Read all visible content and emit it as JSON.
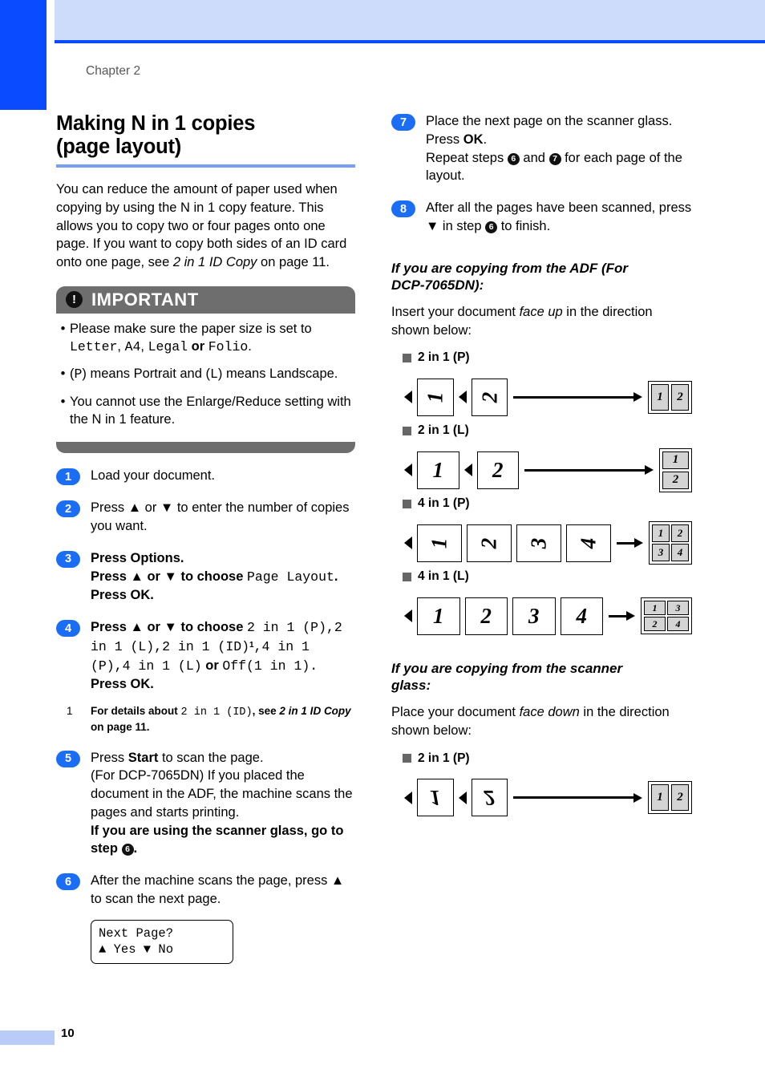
{
  "page": {
    "chapter_label": "Chapter 2",
    "page_number": "10",
    "accent_blue": "#0a4bff",
    "header_band": "#cddcfb",
    "title_rule": "#7a9ef0",
    "step_circle": "#1b6ef3",
    "important_bar": "#6e6e6e"
  },
  "title": {
    "line1": "Making N in 1 copies",
    "line2": "(page layout)"
  },
  "intro": {
    "p1_a": "You can reduce the amount of paper used when copying by using the N in 1 copy feature. This allows you to copy two or four pages onto one page. If you want to copy both sides of an ID card onto one page, see ",
    "p1_italic": "2 in 1 ID Copy",
    "p1_b": " on page 11."
  },
  "important": {
    "icon": "exclamation-icon",
    "title": "IMPORTANT",
    "items": [
      {
        "lead": "Please make sure the paper size is set to ",
        "mono1": "Letter",
        "sep1": ", ",
        "mono2": "A4",
        "sep2": ", ",
        "mono3": "Legal",
        "mid": " or ",
        "mono4": "Folio",
        "tail": "."
      },
      {
        "lead": "(",
        "mono1": "P",
        "mid": ") means Portrait and (",
        "mono2": "L",
        "tail": ") means Landscape."
      },
      {
        "lead": "You cannot use the Enlarge/Reduce setting with the N in 1 feature."
      }
    ]
  },
  "steps": [
    {
      "num": "1",
      "text": "Load your document."
    },
    {
      "num": "2",
      "text": "Press ▲ or ▼ to enter the number of copies you want."
    },
    {
      "num": "3",
      "l1_a": "Press ",
      "l1_b": "Options",
      "l1_c": ".",
      "l2_a": "Press ▲ or ▼ to choose ",
      "l2_mono": "Page Layout",
      "l2_b": ".",
      "l3_a": "Press ",
      "l3_b": "OK",
      "l3_c": "."
    },
    {
      "num": "4",
      "a": "Press ▲ or ▼ to choose ",
      "m1": "2 in 1 (P)",
      "s1": ",",
      "m2": "2 in 1 (L)",
      "s2": ",",
      "m3": "2 in 1 (ID)",
      "sup": "1",
      "s3": ",",
      "m4": "4 in 1 (P)",
      "s4": ",",
      "m5": "4 in 1 (L)",
      "orw": " or ",
      "m6": "Off(1 in 1)",
      "s5": ".",
      "last_a": "Press ",
      "last_b": "OK",
      "last_c": "."
    },
    {
      "num": "5",
      "l1_a": "Press ",
      "l1_b": "Start",
      "l1_c": " to scan the page.",
      "l2": "(For DCP-7065DN) If you placed the document in the ADF, the machine scans the pages and starts printing.",
      "l3_a": "If you are using the scanner glass, go to step ",
      "l3_dot": "6",
      "l3_b": "."
    },
    {
      "num": "6",
      "text": "After the machine scans the page, press ▲ to scan the next page."
    },
    {
      "num": "7",
      "l1": "Place the next page on the scanner glass.",
      "l2_a": "Press ",
      "l2_b": "OK",
      "l2_c": ".",
      "l3_a": "Repeat steps ",
      "l3_dot1": "6",
      "l3_mid": " and ",
      "l3_dot2": "7",
      "l3_b": " for each page of the layout."
    },
    {
      "num": "8",
      "a": "After all the pages have been scanned, press ▼ in step ",
      "dot": "6",
      "b": " to finish."
    }
  ],
  "footnote": {
    "mark": "1",
    "a": "For details about ",
    "mono": "2 in 1 (ID)",
    "b": ", see ",
    "italic": "2 in 1 ID Copy",
    "c": " on page 11."
  },
  "lcd": {
    "line1": "Next Page?",
    "line2": "▲ Yes ▼ No"
  },
  "adf_section": {
    "heading_l1": "If you are copying from the ADF (For",
    "heading_l2": "DCP-7065DN):",
    "intro_a": "Insert your document ",
    "intro_italic": "face up",
    "intro_b": " in the direction shown below:",
    "diagrams": [
      {
        "label": "2 in 1 (P)",
        "sheets": [
          "1",
          "2"
        ],
        "sheet_rotation": "rot",
        "arrow_len": 150,
        "output_type": "two-h",
        "output_cells": [
          "1",
          "2"
        ]
      },
      {
        "label": "2 in 1 (L)",
        "sheets": [
          "1",
          "2"
        ],
        "sheet_rotation": "none",
        "arrow_len": 150,
        "output_type": "two-v",
        "output_cells": [
          "1",
          "2"
        ]
      },
      {
        "label": "4 in 1 (P)",
        "sheets": [
          "1",
          "2",
          "3",
          "4"
        ],
        "sheet_rotation": "rot",
        "arrow_len": 22,
        "output_type": "four",
        "output_cells": [
          "1",
          "2",
          "3",
          "4"
        ]
      },
      {
        "label": "4 in 1 (L)",
        "sheets": [
          "1",
          "2",
          "3",
          "4"
        ],
        "sheet_rotation": "none",
        "arrow_len": 22,
        "output_type": "four-w",
        "output_cells": [
          "1",
          "3",
          "2",
          "4"
        ]
      }
    ]
  },
  "glass_section": {
    "heading_l1": "If you are copying from the scanner",
    "heading_l2": "glass:",
    "intro_a": "Place your document ",
    "intro_italic": "face down",
    "intro_b": " in the direction shown below:",
    "diagrams": [
      {
        "label": "2 in 1 (P)",
        "sheets": [
          "1",
          "2"
        ],
        "sheet_rotation": "flip",
        "arrow_len": 150,
        "output_type": "two-h",
        "output_cells": [
          "1",
          "2"
        ]
      }
    ]
  }
}
